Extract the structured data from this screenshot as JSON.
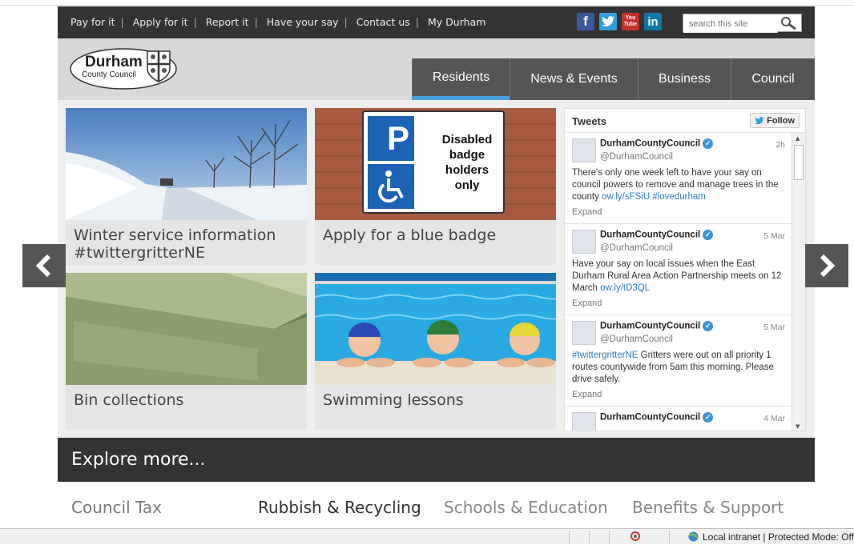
{
  "util_links": [
    "Pay for it",
    "Apply for it",
    "Report it",
    "Have your say",
    "Contact us",
    "My Durham"
  ],
  "social": {
    "facebook": "f",
    "twitter": "t",
    "youtube": "You Tube",
    "linkedin": "in"
  },
  "search": {
    "placeholder": "search this site"
  },
  "logo": {
    "name": "Durham",
    "sub": "County Council"
  },
  "nav": [
    "Residents",
    "News & Events",
    "Business",
    "Council"
  ],
  "tiles": [
    {
      "caption": "Winter service information #twittergritterNE"
    },
    {
      "caption": "Apply for a blue badge",
      "sign": [
        "Disabled",
        "badge",
        "holders",
        "only"
      ],
      "sign_letter": "P"
    },
    {
      "caption": "Bin collections"
    },
    {
      "caption": "Swimming lessons"
    }
  ],
  "tweets": {
    "title": "Tweets",
    "follow": "Follow",
    "items": [
      {
        "name": "DurhamCountyCouncil",
        "handle": "@DurhamCouncil",
        "time": "2h",
        "text": "There's only one week left to have your say on council powers to remove and manage trees in the county ",
        "link": "ow.ly/sFSiU #lovedurham",
        "expand": "Expand"
      },
      {
        "name": "DurhamCountyCouncil",
        "handle": "@DurhamCouncil",
        "time": "5 Mar",
        "text": "Have your say on local issues when the East Durham Rural Area Action Partnership meets on 12 March ",
        "link": "ow.ly/tD3QL",
        "expand": "Expand"
      },
      {
        "name": "DurhamCountyCouncil",
        "handle": "@DurhamCouncil",
        "time": "5 Mar",
        "link": "#twittergritterNE",
        "text": " Gritters were out on all priority 1 routes countywide from 5am this morning. Please drive safely.",
        "expand": "Expand"
      },
      {
        "name": "DurhamCountyCouncil",
        "handle": "",
        "time": "4 Mar",
        "text": "",
        "link": "",
        "expand": ""
      }
    ]
  },
  "explore": {
    "title": "Explore more..."
  },
  "quick_links": [
    "Council Tax",
    "Rubbish & Recycling",
    "Schools & Education",
    "Benefits & Support"
  ],
  "statusbar": {
    "zone": "Local intranet | Protected Mode: Off"
  },
  "colors": {
    "dark": "#333333",
    "accent": "#4aa3df",
    "tab": "#555555",
    "twitter": "#3b94d9"
  }
}
